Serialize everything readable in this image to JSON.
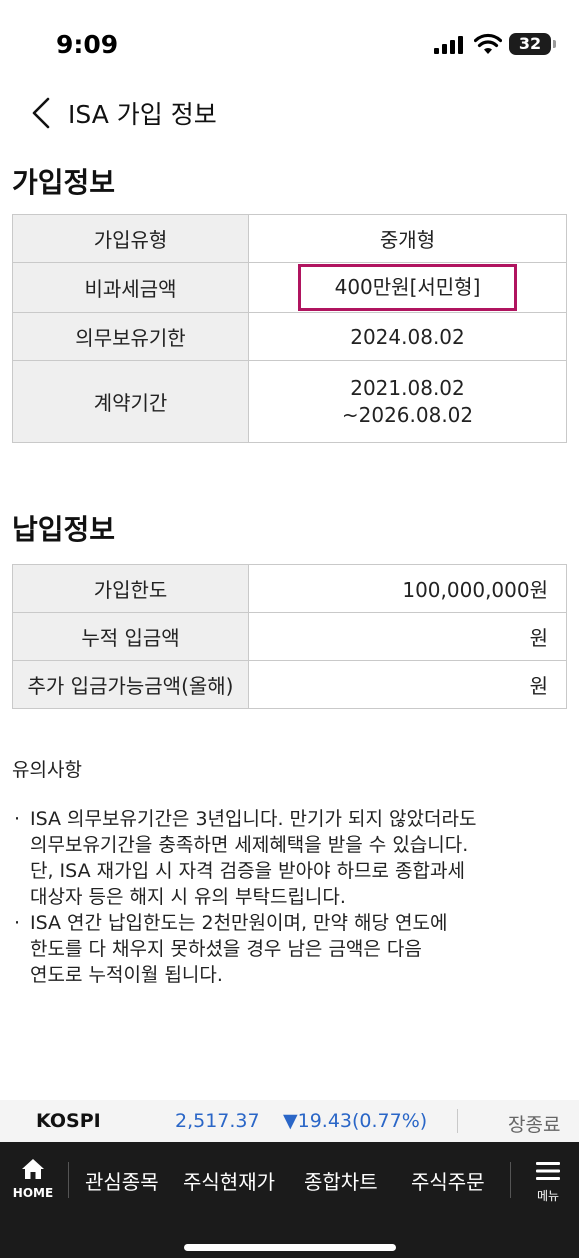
{
  "status_bar": {
    "time": "9:09",
    "battery": "32"
  },
  "header": {
    "title": "ISA 가입 정보"
  },
  "join_info": {
    "title": "가입정보",
    "rows": [
      {
        "label": "가입유형",
        "value": "중개형"
      },
      {
        "label": "비과세금액",
        "value": "400만원[서민형]"
      },
      {
        "label": "의무보유기한",
        "value": "2024.08.02"
      },
      {
        "label": "계약기간",
        "value_line1": "2021.08.02",
        "value_line2": "~2026.08.02"
      }
    ]
  },
  "payment_info": {
    "title": "납입정보",
    "rows": [
      {
        "label": "가입한도",
        "value": "100,000,000원"
      },
      {
        "label": "누적 입금액",
        "value": "원"
      },
      {
        "label": "추가 입금가능금액(올해)",
        "value": "원"
      }
    ]
  },
  "notice": {
    "title": "유의사항",
    "bullet": "·",
    "items": [
      {
        "line1": "ISA 의무보유기간은 3년입니다. 만기가 되지 않았더라도",
        "line2": "의무보유기간을 충족하면 세제혜택을 받을 수 있습니다.",
        "line3": "단, ISA 재가입 시 자격 검증을 받아야 하므로 종합과세",
        "line4": "대상자 등은 해지 시 유의 부탁드립니다."
      },
      {
        "line1": "ISA 연간 납입한도는 2천만원이며, 만약 해당 연도에",
        "line2": "한도를 다 채우지 못하셨을 경우 남은 금액은 다음",
        "line3": "연도로 누적이월 됩니다."
      }
    ]
  },
  "ticker": {
    "name": "KOSPI",
    "value": "2,517.37",
    "change": "▼19.43(0.77%)",
    "status": "장종료",
    "color": "#2a66c7"
  },
  "bottom_nav": {
    "home_label": "HOME",
    "tabs": [
      "관심종목",
      "주식현재가",
      "종합차트",
      "주식주문"
    ],
    "menu_label": "메뉴"
  },
  "colors": {
    "highlight": "#b0145f",
    "header_cell": "#efefef",
    "bottom_bar": "#1b1b1b"
  }
}
